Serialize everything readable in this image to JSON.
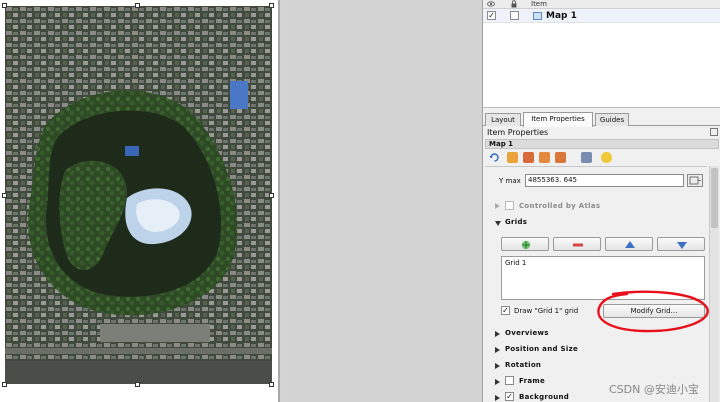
{
  "items_panel": {
    "column_item": "Item",
    "rows": [
      {
        "label": "Map 1",
        "visible": true,
        "locked": false
      }
    ]
  },
  "tabs": [
    {
      "label": "Layout",
      "active": false
    },
    {
      "label": "Item Properties",
      "active": true
    },
    {
      "label": "Guides",
      "active": false
    }
  ],
  "item_properties": {
    "title": "Item Properties",
    "item_name": "Map 1",
    "y_max_label": "Y max",
    "y_max_value": "4855363. 645",
    "controlled_by_atlas": "Controlled by Atlas",
    "grids_label": "Grids",
    "grid_items": [
      "Grid 1"
    ],
    "draw_grid_label": "Draw \"Grid 1\" grid",
    "draw_grid_checked": true,
    "modify_grid_button": "Modify Grid…"
  },
  "sections": [
    {
      "label": "Overviews",
      "checkbox": false
    },
    {
      "label": "Position and Size",
      "checkbox": false
    },
    {
      "label": "Rotation",
      "checkbox": false
    },
    {
      "label": "Frame",
      "checkbox": true,
      "checked": false
    },
    {
      "label": "Background",
      "checkbox": true,
      "checked": true
    }
  ],
  "watermark": "CSDN @安迪小宝",
  "colors": {
    "annotation_red": "#e8101a",
    "selection_row": "#eef3fb",
    "map_water": "#1f2b1a",
    "add_grid_green": "#2f8f2f",
    "remove_grid_red": "#d84545",
    "move_arrow_blue": "#3b72c4"
  },
  "icons": {
    "eye": "eye-icon",
    "lock": "lock-icon",
    "map_item": "map-item-icon",
    "refresh": "refresh-icon",
    "set_extent": "set-extent-icon",
    "view_extent": "view-extent-icon",
    "add_grid": "plus-icon",
    "remove_grid": "minus-icon",
    "move_up": "arrow-up-icon",
    "move_down": "arrow-down-icon"
  }
}
